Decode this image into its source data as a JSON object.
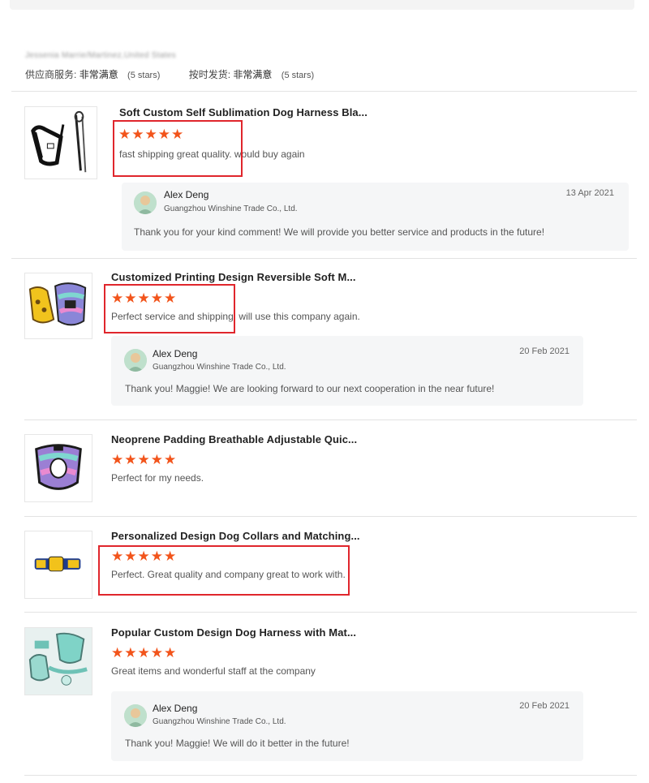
{
  "buyer": {
    "name_blurred": "Jessenia Marrie/Martinez,United States"
  },
  "ratings": {
    "service_label": "供应商服务:",
    "service_value": "非常满意",
    "service_stars": "(5 stars)",
    "delivery_label": "按时发货:",
    "delivery_value": "非常满意",
    "delivery_stars": "(5 stars)"
  },
  "reviews": [
    {
      "title": "Soft Custom Self Sublimation Dog Harness Bla...",
      "stars": "★★★★★",
      "rating": 5,
      "comment": "fast shipping great quality. would buy again",
      "reply": {
        "name": "Alex Deng",
        "company": "Guangzhou Winshine Trade Co., Ltd.",
        "date": "13 Apr 2021",
        "text": "Thank you for your kind comment! We will provide you better service and products in the future!"
      }
    },
    {
      "title": "Customized Printing Design Reversible Soft M...",
      "stars": "★★★★★",
      "rating": 5,
      "comment": "Perfect service and shipping. will use this company again.",
      "reply": {
        "name": "Alex Deng",
        "company": "Guangzhou Winshine Trade Co., Ltd.",
        "date": "20 Feb 2021",
        "text": "Thank you! Maggie! We are looking forward to our next cooperation in the near future!"
      }
    },
    {
      "title": "Neoprene Padding Breathable Adjustable Quic...",
      "stars": "★★★★★",
      "rating": 5,
      "comment": "Perfect for my needs."
    },
    {
      "title": "Personalized Design Dog Collars and Matching...",
      "stars": "★★★★★",
      "rating": 5,
      "comment": "Perfect. Great quality and company great to work with."
    },
    {
      "title": "Popular Custom Design Dog Harness with Mat...",
      "stars": "★★★★★",
      "rating": 5,
      "comment": "Great items and wonderful staff at the company",
      "reply": {
        "name": "Alex Deng",
        "company": "Guangzhou Winshine Trade Co., Ltd.",
        "date": "20 Feb 2021",
        "text": "Thank you! Maggie! We will do it better in the future!"
      }
    }
  ],
  "colors": {
    "star": "#f2541b",
    "highlight_box": "#e0262c",
    "reply_bg": "#f5f6f7"
  }
}
